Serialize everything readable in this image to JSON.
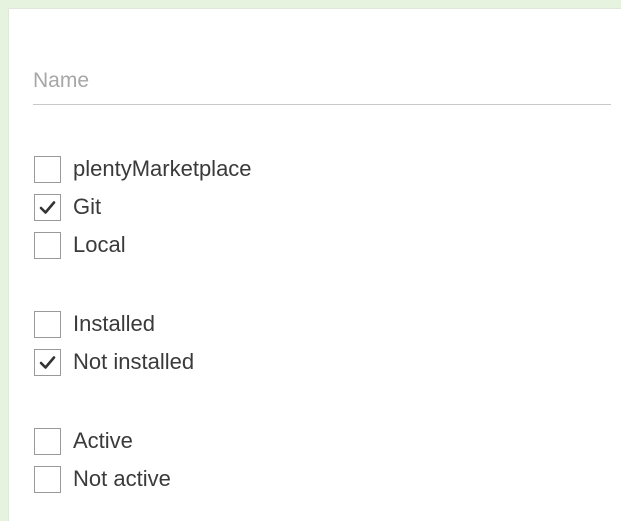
{
  "search": {
    "placeholder": "Name",
    "value": ""
  },
  "filters": {
    "source": [
      {
        "label": "plentyMarketplace",
        "checked": false
      },
      {
        "label": "Git",
        "checked": true
      },
      {
        "label": "Local",
        "checked": false
      }
    ],
    "installation": [
      {
        "label": "Installed",
        "checked": false
      },
      {
        "label": "Not installed",
        "checked": true
      }
    ],
    "activity": [
      {
        "label": "Active",
        "checked": false
      },
      {
        "label": "Not active",
        "checked": false
      }
    ]
  },
  "icons": {
    "checked": "checkmark-icon"
  }
}
